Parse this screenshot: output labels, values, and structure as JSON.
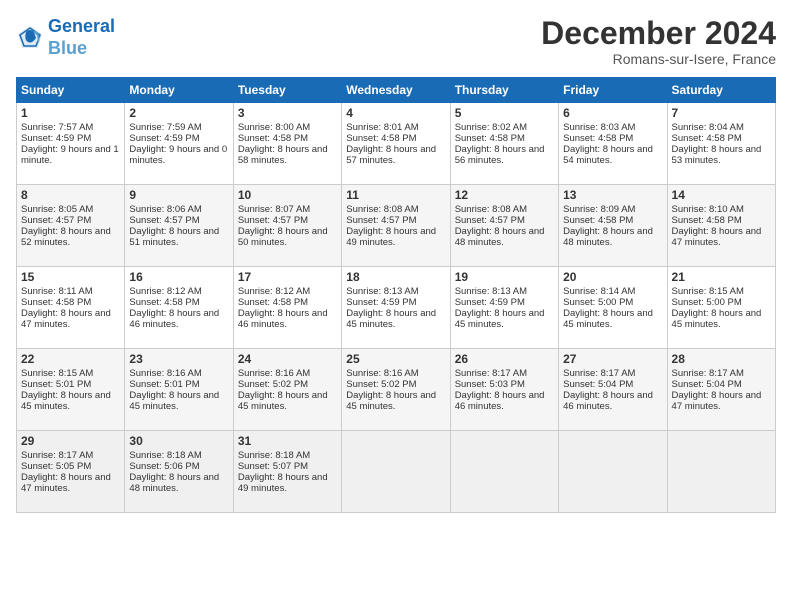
{
  "header": {
    "logo_line1": "General",
    "logo_line2": "Blue",
    "title": "December 2024",
    "location": "Romans-sur-Isere, France"
  },
  "weekdays": [
    "Sunday",
    "Monday",
    "Tuesday",
    "Wednesday",
    "Thursday",
    "Friday",
    "Saturday"
  ],
  "weeks": [
    [
      {
        "day": "1",
        "rise": "Sunrise: 7:57 AM",
        "set": "Sunset: 4:59 PM",
        "day_text": "Daylight: 9 hours and 1 minute."
      },
      {
        "day": "2",
        "rise": "Sunrise: 7:59 AM",
        "set": "Sunset: 4:59 PM",
        "day_text": "Daylight: 9 hours and 0 minutes."
      },
      {
        "day": "3",
        "rise": "Sunrise: 8:00 AM",
        "set": "Sunset: 4:58 PM",
        "day_text": "Daylight: 8 hours and 58 minutes."
      },
      {
        "day": "4",
        "rise": "Sunrise: 8:01 AM",
        "set": "Sunset: 4:58 PM",
        "day_text": "Daylight: 8 hours and 57 minutes."
      },
      {
        "day": "5",
        "rise": "Sunrise: 8:02 AM",
        "set": "Sunset: 4:58 PM",
        "day_text": "Daylight: 8 hours and 56 minutes."
      },
      {
        "day": "6",
        "rise": "Sunrise: 8:03 AM",
        "set": "Sunset: 4:58 PM",
        "day_text": "Daylight: 8 hours and 54 minutes."
      },
      {
        "day": "7",
        "rise": "Sunrise: 8:04 AM",
        "set": "Sunset: 4:58 PM",
        "day_text": "Daylight: 8 hours and 53 minutes."
      }
    ],
    [
      {
        "day": "8",
        "rise": "Sunrise: 8:05 AM",
        "set": "Sunset: 4:57 PM",
        "day_text": "Daylight: 8 hours and 52 minutes."
      },
      {
        "day": "9",
        "rise": "Sunrise: 8:06 AM",
        "set": "Sunset: 4:57 PM",
        "day_text": "Daylight: 8 hours and 51 minutes."
      },
      {
        "day": "10",
        "rise": "Sunrise: 8:07 AM",
        "set": "Sunset: 4:57 PM",
        "day_text": "Daylight: 8 hours and 50 minutes."
      },
      {
        "day": "11",
        "rise": "Sunrise: 8:08 AM",
        "set": "Sunset: 4:57 PM",
        "day_text": "Daylight: 8 hours and 49 minutes."
      },
      {
        "day": "12",
        "rise": "Sunrise: 8:08 AM",
        "set": "Sunset: 4:57 PM",
        "day_text": "Daylight: 8 hours and 48 minutes."
      },
      {
        "day": "13",
        "rise": "Sunrise: 8:09 AM",
        "set": "Sunset: 4:58 PM",
        "day_text": "Daylight: 8 hours and 48 minutes."
      },
      {
        "day": "14",
        "rise": "Sunrise: 8:10 AM",
        "set": "Sunset: 4:58 PM",
        "day_text": "Daylight: 8 hours and 47 minutes."
      }
    ],
    [
      {
        "day": "15",
        "rise": "Sunrise: 8:11 AM",
        "set": "Sunset: 4:58 PM",
        "day_text": "Daylight: 8 hours and 47 minutes."
      },
      {
        "day": "16",
        "rise": "Sunrise: 8:12 AM",
        "set": "Sunset: 4:58 PM",
        "day_text": "Daylight: 8 hours and 46 minutes."
      },
      {
        "day": "17",
        "rise": "Sunrise: 8:12 AM",
        "set": "Sunset: 4:58 PM",
        "day_text": "Daylight: 8 hours and 46 minutes."
      },
      {
        "day": "18",
        "rise": "Sunrise: 8:13 AM",
        "set": "Sunset: 4:59 PM",
        "day_text": "Daylight: 8 hours and 45 minutes."
      },
      {
        "day": "19",
        "rise": "Sunrise: 8:13 AM",
        "set": "Sunset: 4:59 PM",
        "day_text": "Daylight: 8 hours and 45 minutes."
      },
      {
        "day": "20",
        "rise": "Sunrise: 8:14 AM",
        "set": "Sunset: 5:00 PM",
        "day_text": "Daylight: 8 hours and 45 minutes."
      },
      {
        "day": "21",
        "rise": "Sunrise: 8:15 AM",
        "set": "Sunset: 5:00 PM",
        "day_text": "Daylight: 8 hours and 45 minutes."
      }
    ],
    [
      {
        "day": "22",
        "rise": "Sunrise: 8:15 AM",
        "set": "Sunset: 5:01 PM",
        "day_text": "Daylight: 8 hours and 45 minutes."
      },
      {
        "day": "23",
        "rise": "Sunrise: 8:16 AM",
        "set": "Sunset: 5:01 PM",
        "day_text": "Daylight: 8 hours and 45 minutes."
      },
      {
        "day": "24",
        "rise": "Sunrise: 8:16 AM",
        "set": "Sunset: 5:02 PM",
        "day_text": "Daylight: 8 hours and 45 minutes."
      },
      {
        "day": "25",
        "rise": "Sunrise: 8:16 AM",
        "set": "Sunset: 5:02 PM",
        "day_text": "Daylight: 8 hours and 45 minutes."
      },
      {
        "day": "26",
        "rise": "Sunrise: 8:17 AM",
        "set": "Sunset: 5:03 PM",
        "day_text": "Daylight: 8 hours and 46 minutes."
      },
      {
        "day": "27",
        "rise": "Sunrise: 8:17 AM",
        "set": "Sunset: 5:04 PM",
        "day_text": "Daylight: 8 hours and 46 minutes."
      },
      {
        "day": "28",
        "rise": "Sunrise: 8:17 AM",
        "set": "Sunset: 5:04 PM",
        "day_text": "Daylight: 8 hours and 47 minutes."
      }
    ],
    [
      {
        "day": "29",
        "rise": "Sunrise: 8:17 AM",
        "set": "Sunset: 5:05 PM",
        "day_text": "Daylight: 8 hours and 47 minutes."
      },
      {
        "day": "30",
        "rise": "Sunrise: 8:18 AM",
        "set": "Sunset: 5:06 PM",
        "day_text": "Daylight: 8 hours and 48 minutes."
      },
      {
        "day": "31",
        "rise": "Sunrise: 8:18 AM",
        "set": "Sunset: 5:07 PM",
        "day_text": "Daylight: 8 hours and 49 minutes."
      },
      null,
      null,
      null,
      null
    ]
  ]
}
